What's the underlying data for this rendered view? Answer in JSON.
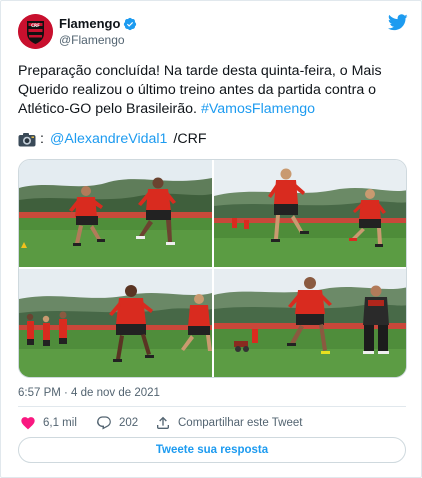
{
  "author": {
    "display_name": "Flamengo",
    "handle": "@Flamengo",
    "verified": true,
    "avatar": "flamengo-crest",
    "brand_color": "#c8102e"
  },
  "tweet": {
    "text_plain": "Preparação concluída! Na tarde desta quinta-feira, o Mais Querido realizou o último treino antes da partida contra o Atlético-GO pelo Brasileirão. ",
    "hashtag": "#VamosFlamengo",
    "credit_separator": ":",
    "credit_mention": "@AlexandreVidal1",
    "credit_suffix": " /CRF",
    "credit_icon": "camera-icon",
    "photo_count": 4
  },
  "timestamp": "6:57 PM · 4 de nov de 2021",
  "actions": {
    "likes": "6,1 mil",
    "replies": "202",
    "share_label": "Compartilhar este Tweet"
  },
  "reply_button_label": "Tweete sua resposta",
  "colors": {
    "accent": "#1d9bf0",
    "text": "#0f1419",
    "secondary": "#536471",
    "like": "#f91880"
  },
  "icons": {
    "platform": "twitter-bird-icon",
    "verified": "verified-badge-icon",
    "like": "heart-icon",
    "reply": "reply-bubble-icon",
    "share": "share-icon"
  }
}
